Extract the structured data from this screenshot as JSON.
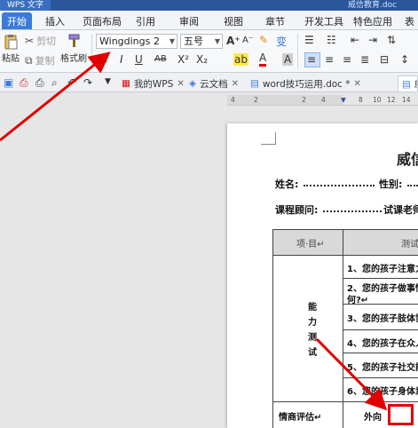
{
  "title_bar": {
    "app_name": "WPS 文字",
    "doc_title": "威信教育.doc"
  },
  "menu": {
    "tabs": [
      "开始",
      "插入",
      "页面布局",
      "引用",
      "审阅",
      "视图",
      "章节",
      "开发工具",
      "特色应用",
      "表格"
    ]
  },
  "ribbon": {
    "paste_label": "粘贴",
    "cut_label": "剪切",
    "copy_label": "复制",
    "format_painter_label": "格式刷",
    "font_name": "Wingdings 2",
    "font_size": "五号",
    "grow_font": "A⁺",
    "shrink_font": "A⁻",
    "bold": "B",
    "italic": "I",
    "underline": "U",
    "strike": "AB",
    "superscript": "X²",
    "subscript": "X₂",
    "highlight": "ab",
    "font_color": "A",
    "char_shade": "A",
    "pinyin": "变"
  },
  "doc_tabs": {
    "my_wps": "我的WPS",
    "cloud_docs": "云文档",
    "word_file": "word技巧运用.doc *",
    "partial": "威"
  },
  "ruler": {
    "ticks": [
      "4",
      "2",
      "2",
      "4",
      "6",
      "8",
      "10",
      "12",
      "14",
      "16",
      "18"
    ]
  },
  "document": {
    "heading": "威信",
    "name_label": "姓名:",
    "gender_label": "性别:",
    "advisor_label": "课程顾问:",
    "trial_teacher_label": "试课老师",
    "table": {
      "header_item": "项·目↵",
      "header_test": "测试",
      "category": [
        "能",
        "力",
        "测",
        "试"
      ],
      "questions": [
        "1、您的孩子注意力",
        "2、您的孩子做事情",
        "何?↵",
        "3、您的孩子肢体协",
        "4、您的孩子在众人",
        "5、您的孩子社交能",
        "6、您的孩子身体素"
      ],
      "eq_label": "情商评估↵",
      "extrovert_label": "外向"
    }
  },
  "colors": {
    "accent": "#3b7bd8",
    "annotation": "#e00000",
    "title_bar": "#2b579a"
  }
}
